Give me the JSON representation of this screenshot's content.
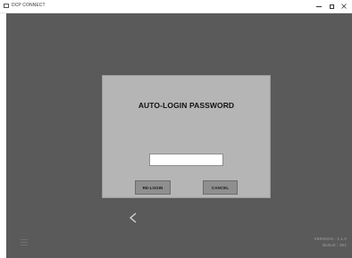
{
  "window": {
    "title": "DCP CONNECT",
    "icon": "window-app-icon",
    "controls": [
      "minimize-icon",
      "maximize-icon",
      "close-icon"
    ]
  },
  "colors": {
    "app_background": "#5a5a5a",
    "dialog_background": "#b5b5b5",
    "button_background": "#8f8f8f",
    "footer_text": "#8c8c8c"
  },
  "dialog": {
    "title": "AUTO-LOGIN PASSWORD",
    "password_value": "",
    "relogin_label": "RE-LOGIN",
    "cancel_label": "CANCEL"
  },
  "navigation": {
    "back_icon": "chevron-left-icon",
    "menu_icon": "hamburger-menu-icon"
  },
  "footer": {
    "version": "VERSION : 1.1.0",
    "build": "BUILD : 461"
  }
}
